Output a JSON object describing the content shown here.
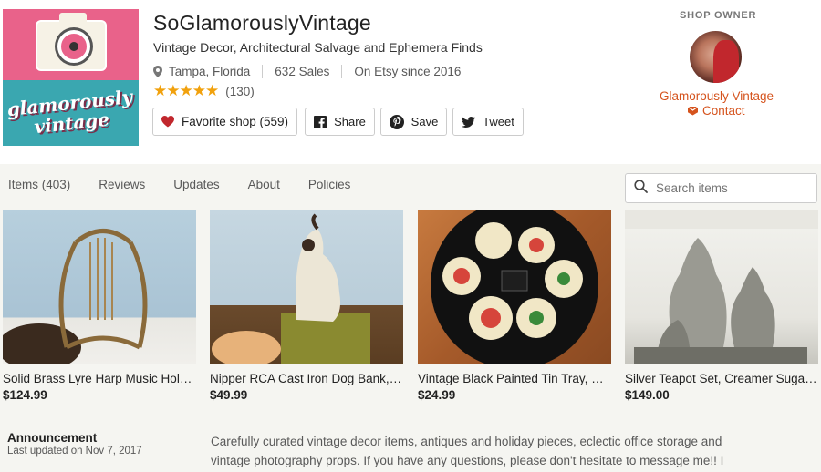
{
  "shop": {
    "logo_text": "glamorously vintage",
    "name": "SoGlamorouslyVintage",
    "tagline": "Vintage Decor, Architectural Salvage and Ephemera Finds",
    "location": "Tampa, Florida",
    "sales": "632 Sales",
    "since": "On Etsy since 2016",
    "stars": "★★★★★",
    "rating_count": "(130)"
  },
  "actions": {
    "favorite_label": "Favorite shop (559)",
    "share_label": "Share",
    "save_label": "Save",
    "tweet_label": "Tweet"
  },
  "owner": {
    "label": "SHOP OWNER",
    "name": "Glamorously Vintage",
    "contact_label": "Contact"
  },
  "nav": {
    "tabs": [
      "Items (403)",
      "Reviews",
      "Updates",
      "About",
      "Policies"
    ]
  },
  "search": {
    "placeholder": "Search items",
    "icon": "search-icon"
  },
  "listings": [
    {
      "title": "Solid Brass Lyre Harp Music Holder Vintage",
      "price": "$124.99"
    },
    {
      "title": "Nipper RCA Cast Iron Dog Bank, Judd",
      "price": "$49.99"
    },
    {
      "title": "Vintage Black Painted Tin Tray, Nesting",
      "price": "$24.99"
    },
    {
      "title": "Silver Teapot Set, Creamer Sugar, Tray",
      "price": "$149.00"
    }
  ],
  "announcement": {
    "title": "Announcement",
    "date": "Last updated on Nov 7, 2017",
    "text": "Carefully curated vintage decor items, antiques and holiday pieces, eclectic office storage and vintage photography props. If you have any questions, please don't hesitate to message me!! I"
  },
  "colors": {
    "accent": "#d5531d",
    "star": "#f1a10d",
    "band": "#f5f5f1",
    "heart": "#c1272d"
  }
}
